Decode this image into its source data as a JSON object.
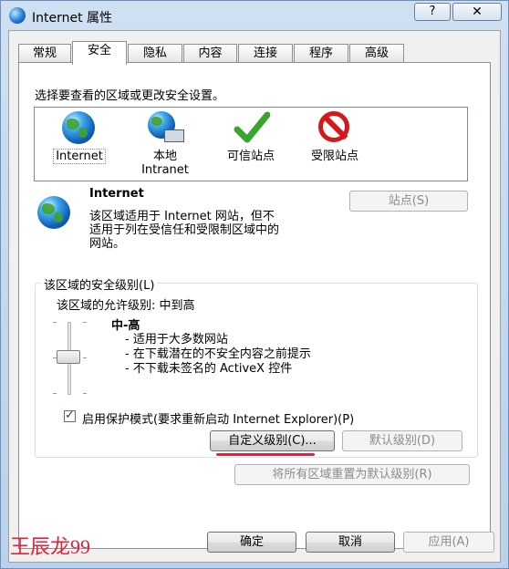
{
  "window": {
    "title": "Internet 属性",
    "help_glyph": "?",
    "close_glyph": "✕"
  },
  "tabs": [
    {
      "label": "常规",
      "active": false
    },
    {
      "label": "安全",
      "active": true
    },
    {
      "label": "隐私",
      "active": false
    },
    {
      "label": "内容",
      "active": false
    },
    {
      "label": "连接",
      "active": false
    },
    {
      "label": "程序",
      "active": false
    },
    {
      "label": "高级",
      "active": false
    }
  ],
  "security": {
    "instruction": "选择要查看的区域或更改安全设置。",
    "zones": [
      {
        "label": "Internet",
        "icon": "globe-icon",
        "selected": true
      },
      {
        "label_line1": "本地",
        "label_line2": "Intranet",
        "icon": "local-intranet-icon"
      },
      {
        "label": "可信站点",
        "icon": "checkmark-icon"
      },
      {
        "label": "受限站点",
        "icon": "no-entry-icon"
      }
    ],
    "zone_title": "Internet",
    "zone_description_lines": [
      "该区域适用于 Internet 网站，但不",
      "适用于列在受信任和受限制区域中的",
      "网站。"
    ],
    "sites_button": "站点(S)",
    "group_title": "该区域的安全级别(L)",
    "allowed_level": "该区域的允许级别: 中到高",
    "level_name": "中-高",
    "level_bullets": [
      "- 适用于大多数网站",
      "- 在下载潜在的不安全内容之前提示",
      "- 不下载未签名的 ActiveX 控件"
    ],
    "protected_mode_label": "启用保护模式(要求重新启动 Internet Explorer)(P)",
    "protected_mode_checked": true,
    "custom_level_button": "自定义级别(C)...",
    "default_level_button": "默认级别(D)",
    "reset_all_button": "将所有区域重置为默认级别(R)"
  },
  "footer": {
    "ok_button": "确定",
    "cancel_button": "取消",
    "apply_button": "应用(A)"
  },
  "watermark": "王辰龙99",
  "colors": {
    "highlight_red": "#e2233d"
  }
}
